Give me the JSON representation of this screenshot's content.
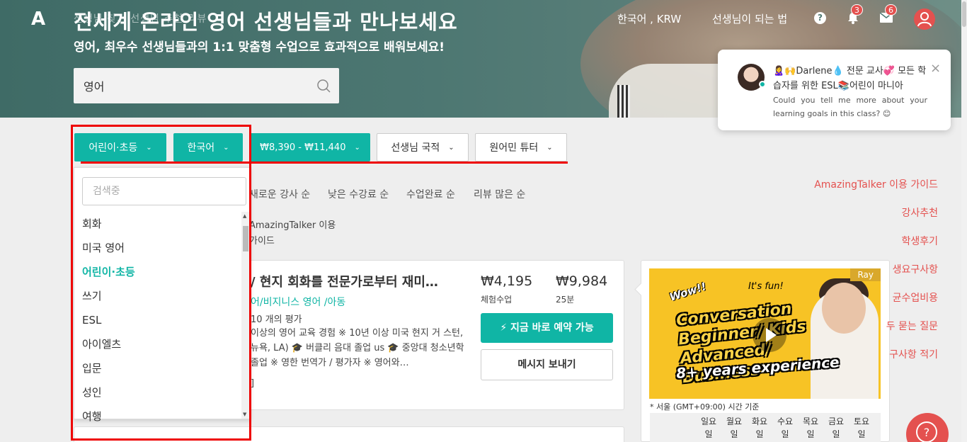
{
  "header": {
    "logo": "A",
    "faint_nav": "선생님 찾기   선생님 추천   리뷰",
    "title": "전세계 온라인 영어 선생님들과 만나보세요",
    "subtitle": "영어, 최우수 선생님들과의 1:1 맞춤형 수업으로 효과적으로 배워보세요!",
    "search_value": "영어",
    "lang_currency": "한국어 , KRW",
    "become_teacher": "선생님이 되는 법",
    "help": "?",
    "notifications_count": "3",
    "messages_count": "6",
    "accent_color": "#10b5a5",
    "alert_color": "#e4514f"
  },
  "filters": [
    {
      "label": "어린이·초등"
    },
    {
      "label": "한국어"
    },
    {
      "label": "₩8,390 - ₩11,440"
    },
    {
      "label": "선생님 국적"
    },
    {
      "label": "원어민 튜터"
    }
  ],
  "dropdown": {
    "search_placeholder": "검색중",
    "items": [
      "회화",
      "미국 영어",
      "어린이·초등",
      "쓰기",
      "ESL",
      "아이엘츠",
      "입문",
      "성인",
      "여행"
    ],
    "selected": "어린이·초등"
  },
  "sort": [
    "새로운 강사 순",
    "낮은 수강료 순",
    "수업완료 순",
    "리뷰 많은 순"
  ],
  "guide": {
    "line1": "AmazingTalker 이용",
    "line2": "가이드"
  },
  "card": {
    "title": "/ 현지 회화를 전문가로부터 재미…",
    "categories": "어/비지니스 영어 /아동",
    "reviews": "10 개의 평가",
    "description": "이상의 영어 교육 경험 ※ 10년 이상 미국 현지 거 스턴, 뉴욕, LA) 🎓 버클리 음대 졸업 us 🎓 중앙대 청소년학 졸업 ※ 영한 번역가 / 평가자 ※ 영어와…",
    "more": "]",
    "trial_price": "₩4,195",
    "trial_label": "체험수업",
    "price": "₩9,984",
    "price_label": "25분",
    "book_button": "⚡ 지금 바로 예약 가능",
    "message_button": "메시지 보내기"
  },
  "video": {
    "wow": "Wow!!",
    "fun": "It's fun!",
    "title": "Conversation Beginner/ Kids Advanced/ Business",
    "sub": "8+ years experience",
    "name": "Ray"
  },
  "schedule": {
    "timezone": "* 서울 (GMT+09:00) 시간 기준",
    "days": [
      "일요일",
      "월요일",
      "화요일",
      "수요일",
      "목요일",
      "금요일",
      "토요일"
    ]
  },
  "right_links": [
    "AmazingTalker 이용 가이드",
    "강사추천",
    "학생후기",
    "생요구사항",
    "균수업비용",
    "두 묻는 질문",
    "구사항 적기"
  ],
  "chat": {
    "title": "🙎‍♀️🙌Darlene💧 전문 교사💞 모든 학습자를 위한 ESL📚어린이 마니아",
    "message": "Could you tell me more about your learning goals in this class? 😊",
    "close": "×"
  }
}
